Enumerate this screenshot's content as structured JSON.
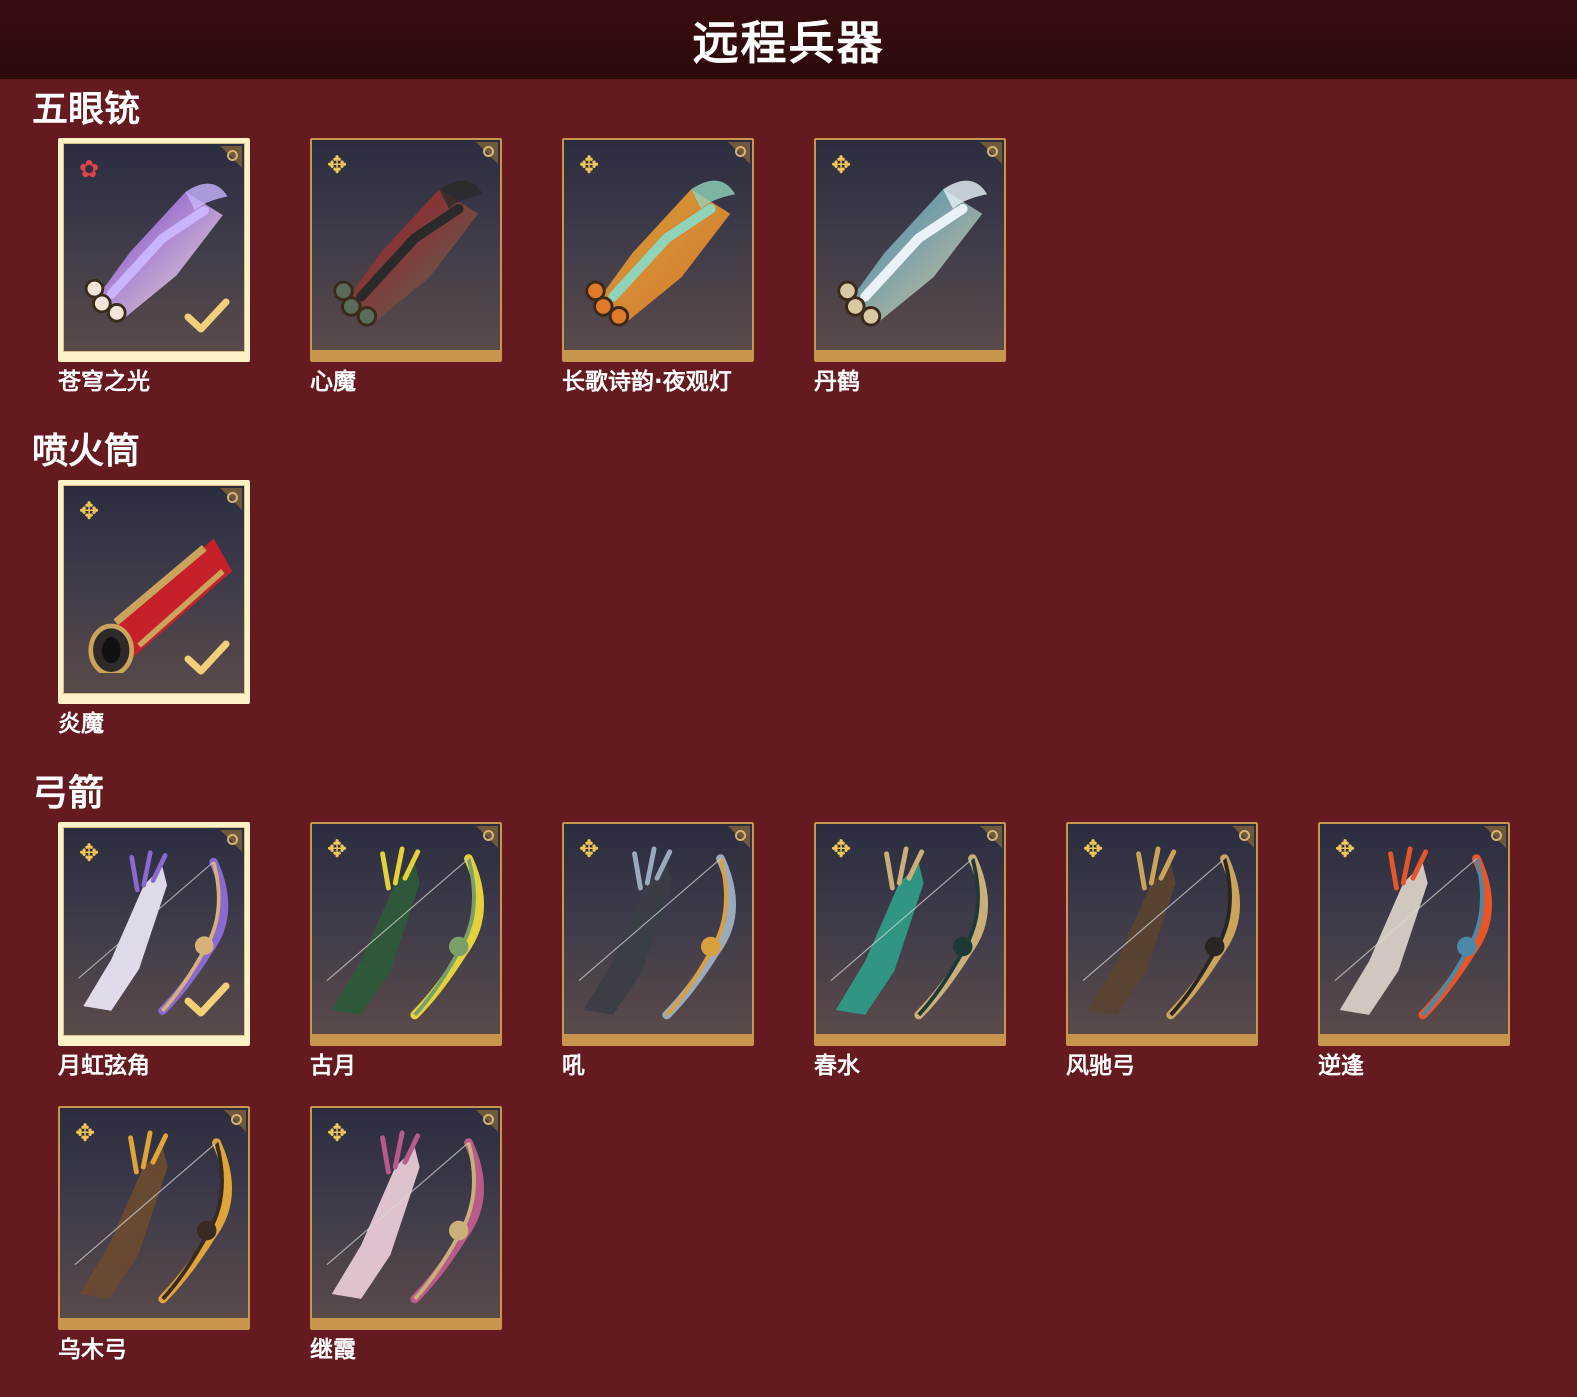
{
  "header": {
    "title": "远程兵器"
  },
  "colors": {
    "background": "#641a1e",
    "header_bg": "#2c0a0c",
    "card_gold": "#c8954f",
    "selected_frame": "#fff2c8",
    "rarity_gold": "#f0c658",
    "rarity_red": "#e0434a"
  },
  "sections": [
    {
      "title": "五眼铳",
      "items": [
        {
          "name": "苍穹之光",
          "selected": true,
          "rarity": "red-flower-icon",
          "palette": [
            "#c9b4ff",
            "#7a3fd6",
            "#f2e6d8"
          ]
        },
        {
          "name": "心魔",
          "selected": false,
          "rarity": "gold-flower-icon",
          "palette": [
            "#2a2a2a",
            "#a8121c",
            "#5a6b5a"
          ]
        },
        {
          "name": "长歌诗韵·夜观灯",
          "selected": false,
          "rarity": "gold-flower-icon",
          "palette": [
            "#8fd3b9",
            "#d9a33a",
            "#e07a2a"
          ]
        },
        {
          "name": "丹鹤",
          "selected": false,
          "rarity": "gold-flower-icon",
          "palette": [
            "#e9f2f7",
            "#3a8bb5",
            "#d8c9a2"
          ]
        }
      ]
    },
    {
      "title": "喷火筒",
      "items": [
        {
          "name": "炎魔",
          "selected": true,
          "rarity": "gold-flower-icon",
          "palette": [
            "#c6202a",
            "#c9a45a",
            "#2f2a2a"
          ]
        }
      ]
    },
    {
      "title": "弓箭",
      "items": [
        {
          "name": "月虹弦角",
          "selected": true,
          "rarity": "gold-flower-icon",
          "palette": [
            "#e8e3f2",
            "#8a6ad0",
            "#d6b27a"
          ]
        },
        {
          "name": "古月",
          "selected": false,
          "rarity": "gold-flower-icon",
          "palette": [
            "#2e5a3a",
            "#e3d23a",
            "#7aa06a"
          ]
        },
        {
          "name": "吼",
          "selected": false,
          "rarity": "gold-flower-icon",
          "palette": [
            "#3a3e44",
            "#9aaabb",
            "#d9a040"
          ]
        },
        {
          "name": "春水",
          "selected": false,
          "rarity": "gold-flower-icon",
          "palette": [
            "#2f9a86",
            "#c9b07a",
            "#1f3a36"
          ]
        },
        {
          "name": "风驰弓",
          "selected": false,
          "rarity": "gold-flower-icon",
          "palette": [
            "#5a4330",
            "#c9a45a",
            "#2a2624"
          ]
        },
        {
          "name": "逆逢",
          "selected": false,
          "rarity": "gold-flower-icon",
          "palette": [
            "#d8cfc4",
            "#e5572a",
            "#4a8aa8"
          ]
        },
        {
          "name": "乌木弓",
          "selected": false,
          "rarity": "gold-flower-icon",
          "palette": [
            "#6a4a30",
            "#e0a53a",
            "#3a2a22"
          ]
        },
        {
          "name": "继霞",
          "selected": false,
          "rarity": "gold-flower-icon",
          "palette": [
            "#e7c9d6",
            "#b85a8a",
            "#c9b07a"
          ]
        }
      ]
    }
  ]
}
